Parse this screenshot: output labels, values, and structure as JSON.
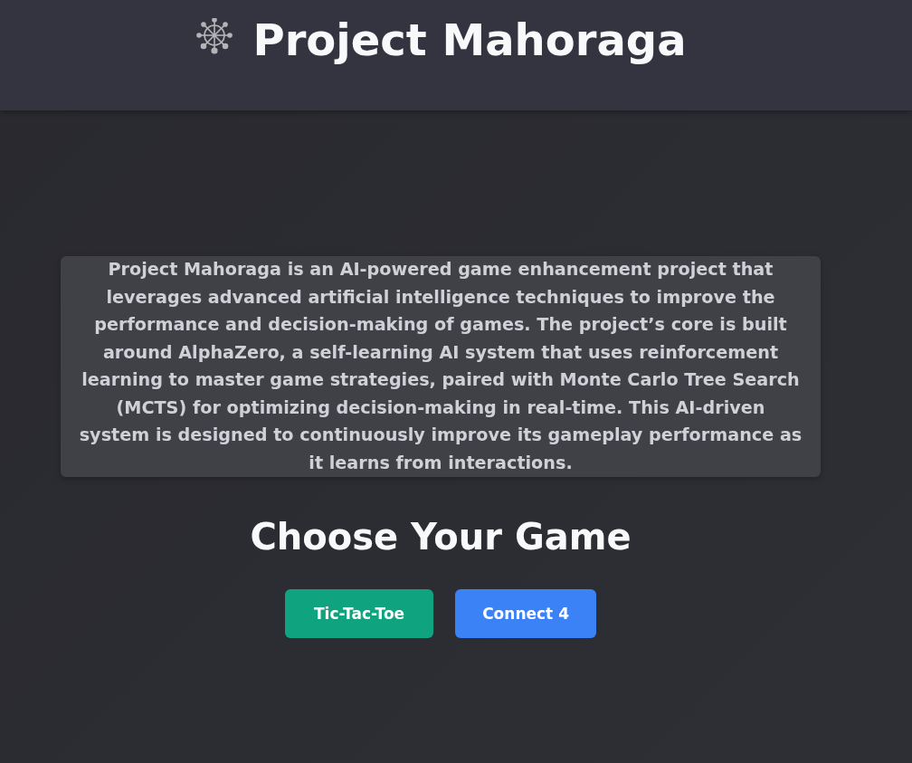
{
  "header": {
    "title": "Project Mahoraga"
  },
  "description": "Project Mahoraga is an AI-powered game enhancement project that leverages advanced artificial intelligence techniques to improve the performance and decision-making of games. The project’s core is built around AlphaZero, a self-learning AI system that uses reinforcement learning to master game strategies, paired with Monte Carlo Tree Search (MCTS) for optimizing decision-making in real-time. This AI-driven system is designed to continuously improve its gameplay performance as it learns from interactions.",
  "games": {
    "heading": "Choose Your Game",
    "buttons": [
      {
        "label": "Tic-Tac-Toe",
        "color": "#10a37f"
      },
      {
        "label": "Connect 4",
        "color": "#3b82f6"
      }
    ]
  }
}
